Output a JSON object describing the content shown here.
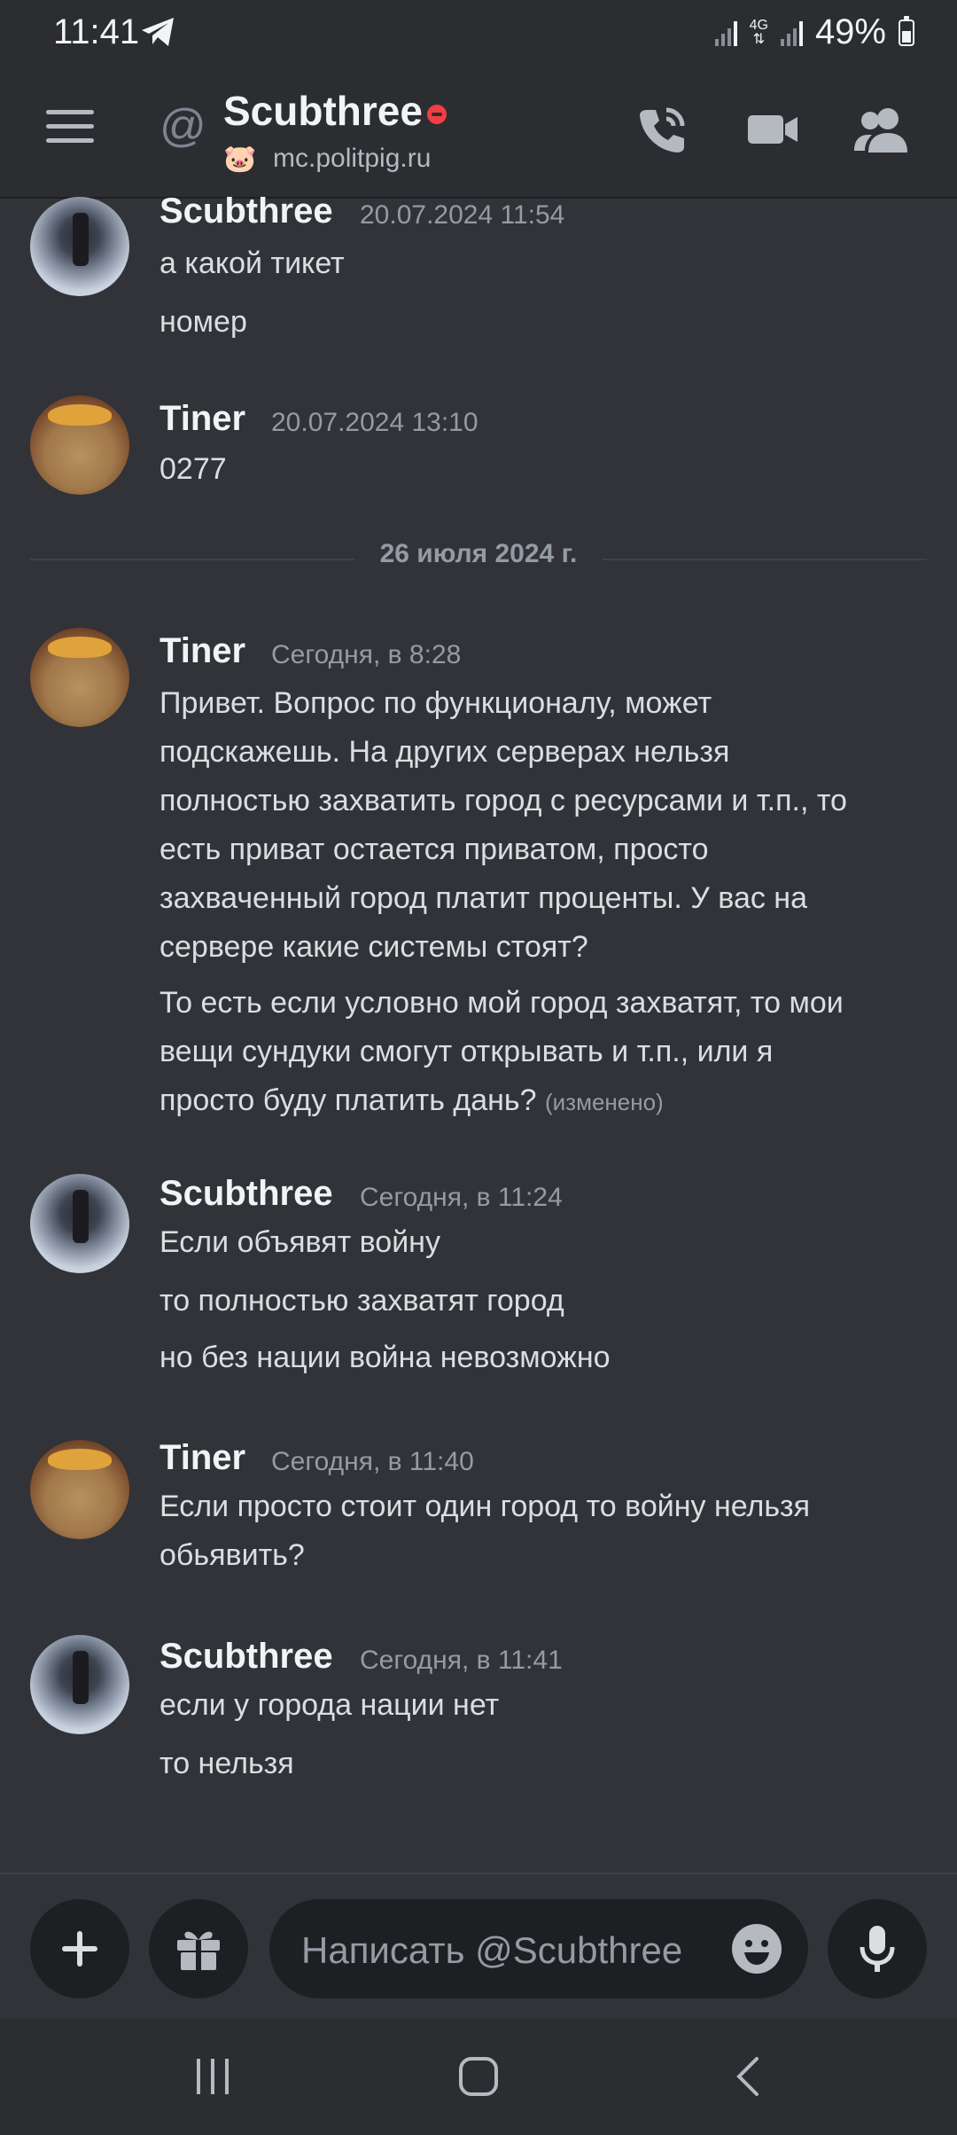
{
  "status_bar": {
    "time": "11:41",
    "network": "4G",
    "battery": "49%",
    "battery_level": 0.49
  },
  "header": {
    "at_symbol": "@",
    "title": "Scubthree",
    "subtitle": "mc.politpig.ru",
    "status": "do-not-disturb",
    "status_color": "#f23f43"
  },
  "messages": [
    {
      "author": "Scubthree",
      "timestamp": "20.07.2024 11:54",
      "lines": [
        "а какой тикет",
        "номер"
      ]
    },
    {
      "author": "Tiner",
      "timestamp": "20.07.2024 13:10",
      "lines": [
        "0277"
      ]
    },
    {
      "author": "Tiner",
      "timestamp": "Сегодня, в 8:28",
      "lines": [
        "Привет. Вопрос по функционалу, может",
        "подскажешь. На других серверах нельзя",
        "полностью захватить город с ресурсами и т.п., то",
        "есть приват остается приватом, просто",
        "захваченный город платит проценты. У вас на",
        "сервере какие системы стоят?",
        "То есть если условно мой город захватят, то мои",
        "вещи сундуки смогут открывать и т.п., или я",
        "просто буду платить  дань?"
      ],
      "edited": "(изменено)"
    },
    {
      "author": "Scubthree",
      "timestamp": "Сегодня, в 11:24",
      "lines": [
        "Если объявят войну",
        "то полностью захватят город",
        "но без нации война невозможно"
      ]
    },
    {
      "author": "Tiner",
      "timestamp": "Сегодня, в 11:40",
      "lines": [
        "Если просто стоит один город то войну нельзя",
        "обьявить?"
      ]
    },
    {
      "author": "Scubthree",
      "timestamp": "Сегодня, в 11:41",
      "lines": [
        "если у города нации нет",
        "то нельзя"
      ]
    }
  ],
  "date_divider": "26 июля 2024 г.",
  "composer": {
    "placeholder": "Написать @Scubthree"
  },
  "icons": {
    "menu": "hamburger-icon",
    "call": "phone-call-icon",
    "video": "video-camera-icon",
    "members": "members-icon",
    "add": "plus-icon",
    "gift": "gift-icon",
    "emoji": "emoji-icon",
    "mic": "microphone-icon"
  },
  "colors": {
    "background": "#313338",
    "header": "#2b2d31",
    "text": "#dbdee1",
    "muted": "#949ba4"
  }
}
